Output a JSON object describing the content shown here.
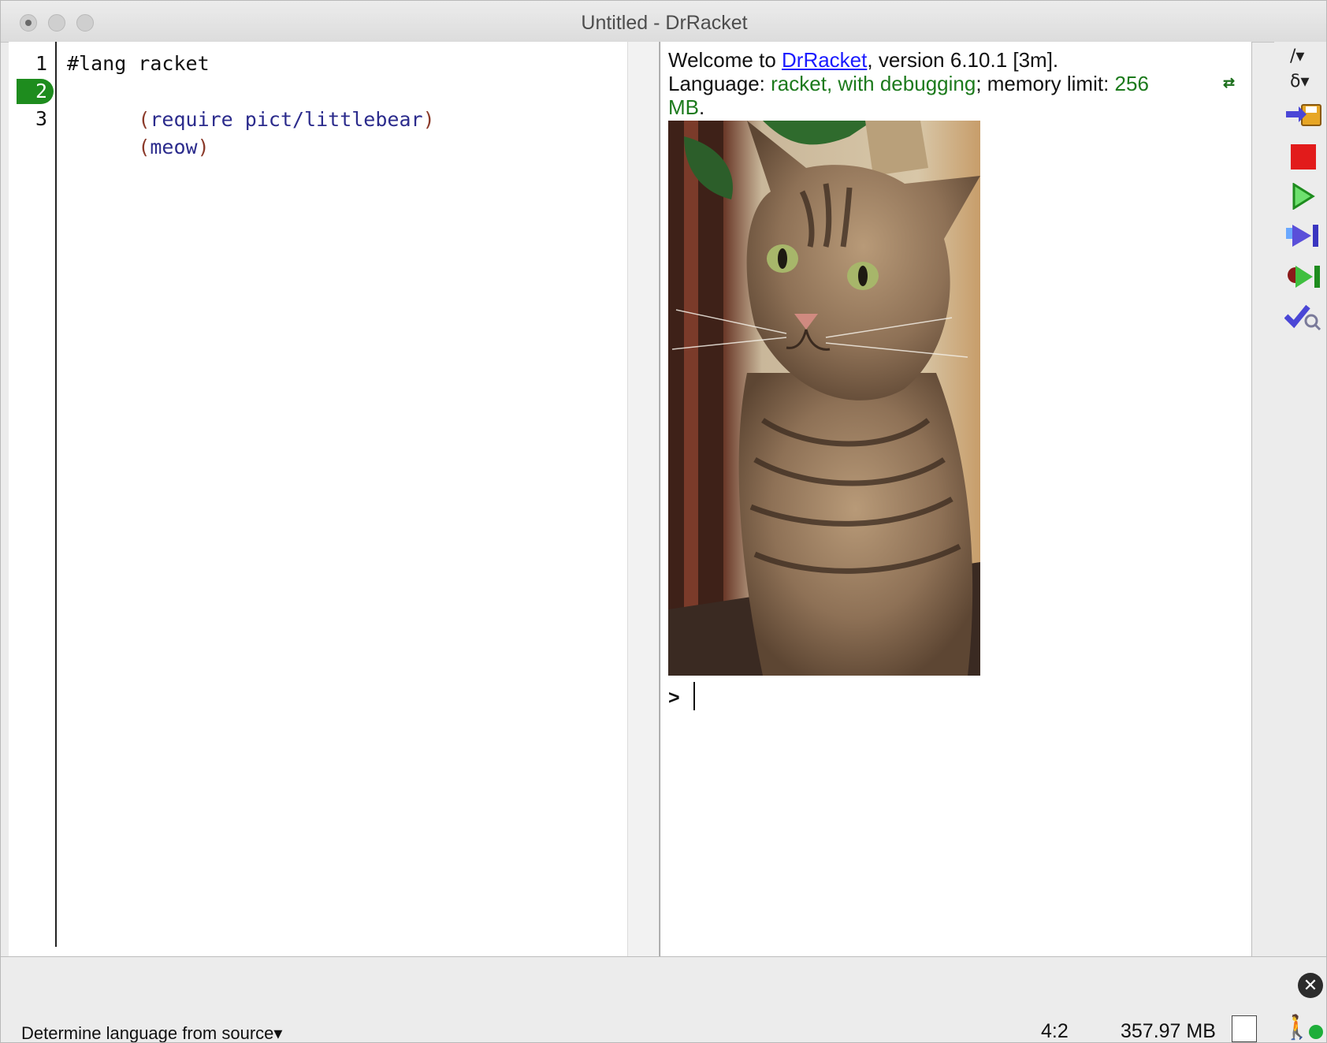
{
  "window": {
    "title": "Untitled - DrRacket"
  },
  "editor": {
    "line_numbers": [
      "1",
      "2",
      "3"
    ],
    "lines": {
      "l1": "#lang racket",
      "l2": "(require pict/littlebear)",
      "l3": "(meow)"
    }
  },
  "repl": {
    "welcome_prefix": "Welcome to ",
    "drracket_link": "DrRacket",
    "welcome_suffix": ", version 6.10.1 [3m].",
    "lang_prefix": "Language: ",
    "lang_name": "racket, with debugging",
    "mem_prefix": "; memory limit: ",
    "mem_value": "256",
    "mem_unit": "MB",
    "mem_dot": ".",
    "prompt": ">"
  },
  "toolbar": {
    "items": [
      "slash-menu-icon",
      "delta-menu-icon",
      "save-icon",
      "stop-icon",
      "run-icon",
      "step-icon",
      "debug-icon",
      "check-syntax-icon"
    ],
    "slash_label": "/",
    "delta_label": "δ"
  },
  "status": {
    "language": "Determine language from source",
    "position": "4:2",
    "memory": "357.97 MB"
  },
  "colors": {
    "keyword_green": "#1c7a1c",
    "code_paren": "#8b3a2a",
    "code_symbol": "#2b2b8c",
    "link_blue": "#1a1aff",
    "active_line": "#1e8c1e"
  }
}
